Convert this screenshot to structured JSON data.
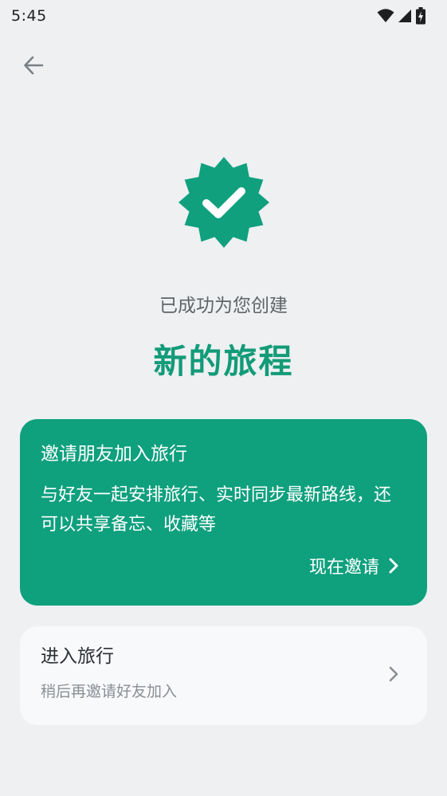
{
  "status_bar": {
    "time": "5:45"
  },
  "header": {
    "back_icon": "arrow-left-icon"
  },
  "hero": {
    "badge_icon": "verified-check-badge-icon",
    "subtitle": "已成功为您创建",
    "title": "新的旅程"
  },
  "invite_card": {
    "title": "邀请朋友加入旅行",
    "description": "与好友一起安排旅行、实时同步最新路线，还可以共享备忘、收藏等",
    "action_label": "现在邀请",
    "action_icon": "chevron-right-icon"
  },
  "enter_card": {
    "title": "进入旅行",
    "subtitle": "稍后再邀请好友加入",
    "chevron_icon": "chevron-right-icon"
  },
  "colors": {
    "accent": "#0fa07e",
    "background": "#eef0f2"
  }
}
